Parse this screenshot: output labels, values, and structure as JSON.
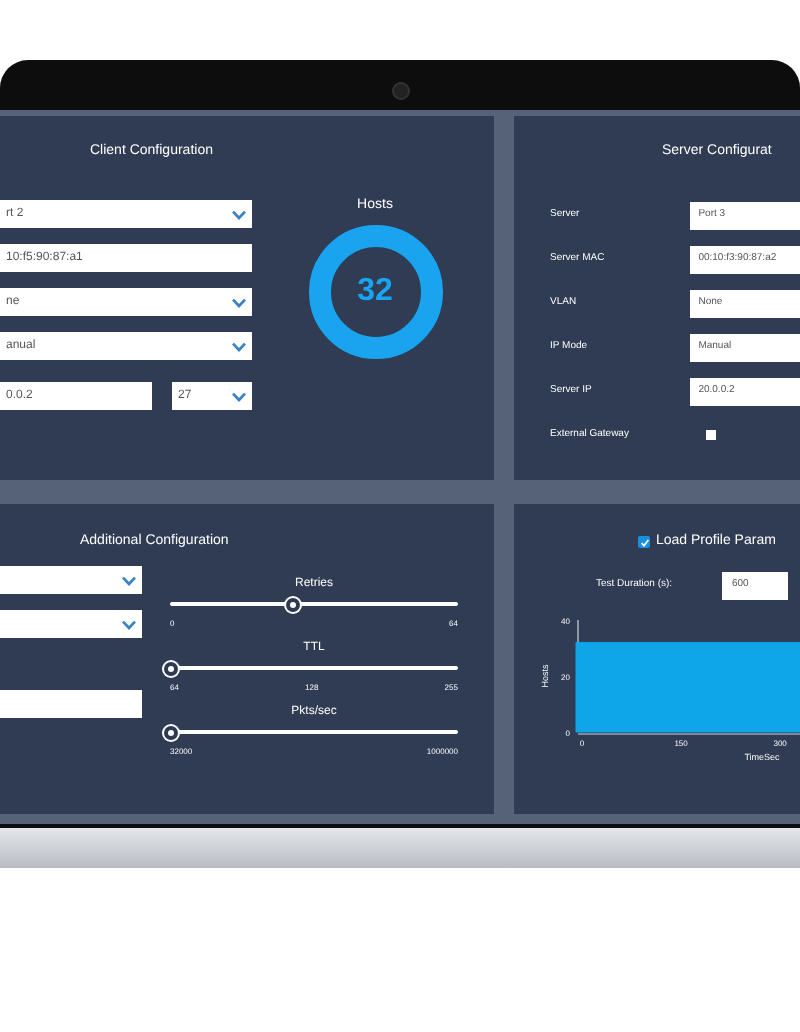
{
  "client_configuration": {
    "title": "Client Configuration",
    "fields": [
      {
        "kind": "select",
        "value": "rt 2"
      },
      {
        "kind": "text",
        "value": "10:f5:90:87:a1"
      },
      {
        "kind": "select",
        "value": "ne"
      },
      {
        "kind": "select",
        "value": "anual"
      }
    ],
    "ip_field": {
      "kind": "text",
      "value": "0.0.2"
    },
    "prefix_field": {
      "kind": "select",
      "value": "27"
    },
    "hosts": {
      "label": "Hosts",
      "value": "32"
    }
  },
  "server_configuration": {
    "title": "Server Configurat",
    "rows": [
      {
        "label": "Server",
        "kind": "select",
        "value": "Port 3"
      },
      {
        "label": "Server MAC",
        "kind": "text",
        "value": "00:10:f3:90:87:a2"
      },
      {
        "label": "VLAN",
        "kind": "select",
        "value": "None"
      },
      {
        "label": "IP Mode",
        "kind": "select",
        "value": "Manual"
      },
      {
        "label": "Server IP",
        "kind": "text",
        "value": "20.0.0.2"
      },
      {
        "label": "External Gateway",
        "kind": "checkbox",
        "checked": false
      }
    ]
  },
  "additional_configuration": {
    "title": "Additional Configuration",
    "fields": [
      {
        "kind": "select"
      },
      {
        "kind": "select"
      },
      {
        "kind": "text"
      }
    ],
    "sliders": [
      {
        "label": "Retries",
        "level": 0.43,
        "ticks": [
          "0",
          "64"
        ]
      },
      {
        "label": "TTL",
        "level": 0,
        "ticks": [
          "64",
          "128",
          "255"
        ]
      },
      {
        "label": "Pkts/sec",
        "level": 0,
        "ticks": [
          "32000",
          "1000000"
        ]
      }
    ]
  },
  "load_profile": {
    "title": "Load Profile Param",
    "checked": true,
    "duration_label": "Test Duration (s):",
    "duration_value": "600",
    "chart_data": {
      "type": "area",
      "xlabel": "TimeSec",
      "ylabel": "Hosts",
      "x": [
        0,
        330
      ],
      "series": [
        {
          "color": "#0ea5e9",
          "values": [
            32,
            32
          ]
        }
      ],
      "xlim": [
        0,
        330
      ],
      "ylim": [
        0,
        40
      ],
      "xticks": [
        0,
        150,
        300
      ],
      "yticks": [
        0,
        20,
        40
      ]
    }
  }
}
